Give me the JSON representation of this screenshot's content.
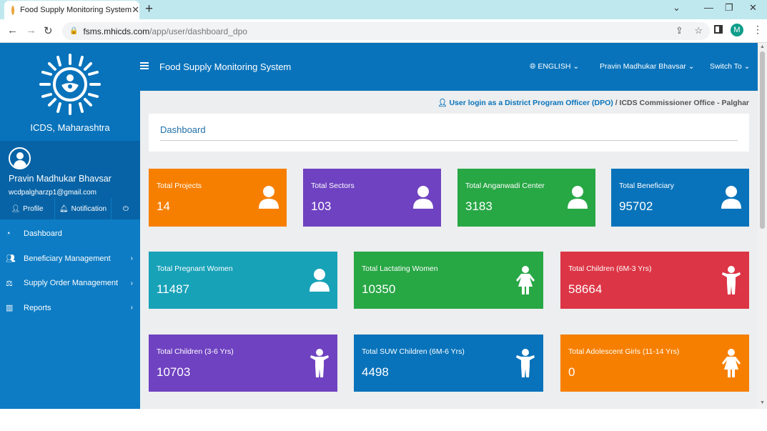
{
  "browser": {
    "tab_title": "Food Supply Monitoring System",
    "tab_close": "✕",
    "new_tab": "+",
    "url_host": "fsms.mhicds.com",
    "url_path": "/app/user/dashboard_dpo",
    "profile_initial": "M"
  },
  "sidebar": {
    "org_name": "ICDS, Maharashtra",
    "user_name": "Pravin Madhukar Bhavsar",
    "user_email": "wcdpalgharzp1@gmail.com",
    "buttons": {
      "profile": "Profile",
      "notification": "Notification"
    },
    "menu": [
      {
        "label": "Dashboard",
        "icon": "dashboard-icon"
      },
      {
        "label": "Beneficiary Management",
        "icon": "users-icon"
      },
      {
        "label": "Supply Order Management",
        "icon": "balance-scale-icon"
      },
      {
        "label": "Reports",
        "icon": "bar-chart-icon"
      }
    ]
  },
  "header": {
    "app_title": "Food Supply Monitoring System",
    "language": "ENGLISH",
    "user": "Pravin Madhukar Bhavsar",
    "switch": "Switch To"
  },
  "content": {
    "login_prefix": "User login as a District Program Officer (DPO)",
    "login_suffix": " / ICDS Commissioner Office - Palghar",
    "dashboard_title": "Dashboard"
  },
  "stats": [
    {
      "label": "Total Projects",
      "value": "14",
      "color": "#f77f00",
      "icon": "user-icon"
    },
    {
      "label": "Total Sectors",
      "value": "103",
      "color": "#6f42c1",
      "icon": "user-icon"
    },
    {
      "label": "Total Anganwadi Center",
      "value": "3183",
      "color": "#28a745",
      "icon": "user-icon"
    },
    {
      "label": "Total Beneficiary",
      "value": "95702",
      "color": "#0873bb",
      "icon": "user-icon"
    },
    {
      "label": "Total Pregnant Women",
      "value": "11487",
      "color": "#17a2b8",
      "icon": "user-icon"
    },
    {
      "label": "Total Lactating Women",
      "value": "10350",
      "color": "#28a745",
      "icon": "female-icon"
    },
    {
      "label": "Total Children (6M-3 Yrs)",
      "value": "58664",
      "color": "#dc3545",
      "icon": "child-icon"
    },
    {
      "label": "Total Children (3-6 Yrs)",
      "value": "10703",
      "color": "#6f42c1",
      "icon": "child-icon"
    },
    {
      "label": "Total SUW Children (6M-6 Yrs)",
      "value": "4498",
      "color": "#0873bb",
      "icon": "child-icon"
    },
    {
      "label": "Total Adolescent Girls (11-14 Yrs)",
      "value": "0",
      "color": "#f77f00",
      "icon": "female-icon"
    }
  ]
}
